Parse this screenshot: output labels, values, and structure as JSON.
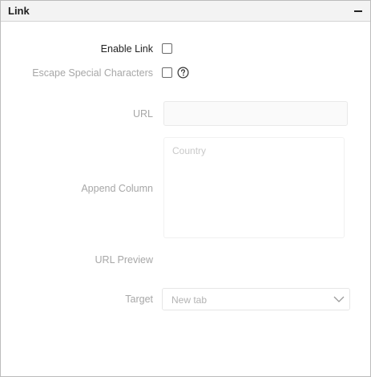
{
  "panel": {
    "title": "Link",
    "collapse_icon": "minus-icon"
  },
  "fields": {
    "enable_link": {
      "label": "Enable Link",
      "checked": false
    },
    "escape_special": {
      "label": "Escape Special Characters",
      "checked": false,
      "help_icon": "question-circle-icon"
    },
    "url": {
      "label": "URL",
      "value": ""
    },
    "append_column": {
      "label": "Append Column",
      "placeholder": "Country"
    },
    "url_preview": {
      "label": "URL Preview"
    },
    "target": {
      "label": "Target",
      "selected": "New tab",
      "dropdown_icon": "chevron-down-icon"
    }
  }
}
